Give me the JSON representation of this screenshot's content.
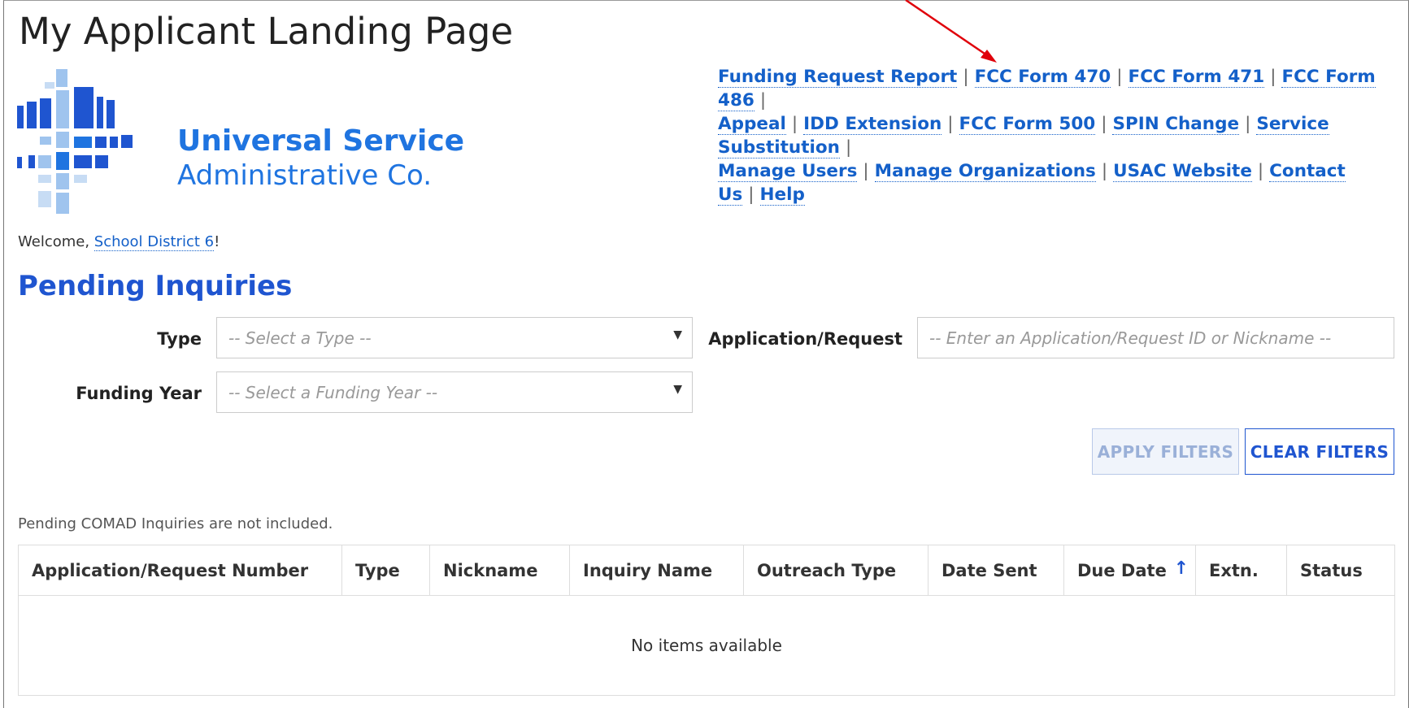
{
  "page": {
    "title": "My Applicant Landing Page"
  },
  "logo": {
    "line1": "Universal Service",
    "line2": "Administrative Co."
  },
  "top_links": [
    "Funding Request Report",
    "FCC Form 470",
    "FCC Form 471",
    "FCC Form 486",
    "Appeal",
    "IDD Extension",
    "FCC Form 500",
    "SPIN Change",
    "Service Substitution",
    "Manage Users",
    "Manage Organizations",
    "USAC Website",
    "Contact Us",
    "Help"
  ],
  "welcome": {
    "prefix": "Welcome, ",
    "org": "School District 6",
    "suffix": "!"
  },
  "section": {
    "title": "Pending Inquiries"
  },
  "filters": {
    "type_label": "Type",
    "type_placeholder": "-- Select a Type --",
    "app_label": "Application/Request",
    "app_placeholder": "-- Enter an Application/Request ID or Nickname --",
    "fy_label": "Funding Year",
    "fy_placeholder": "-- Select a Funding Year --",
    "apply": "APPLY FILTERS",
    "clear": "CLEAR FILTERS"
  },
  "note": "Pending COMAD Inquiries are not included.",
  "table": {
    "columns": [
      "Application/Request Number",
      "Type",
      "Nickname",
      "Inquiry Name",
      "Outreach Type",
      "Date Sent",
      "Due Date",
      "Extn.",
      "Status"
    ],
    "empty": "No items available"
  },
  "colors": {
    "accent": "#1f55d0",
    "link": "#1460c9",
    "logo": "#1f74e0",
    "arrow": "#e0000a"
  },
  "icons": {
    "sort": "arrow-up-icon",
    "dropdown": "caret-down-icon"
  }
}
